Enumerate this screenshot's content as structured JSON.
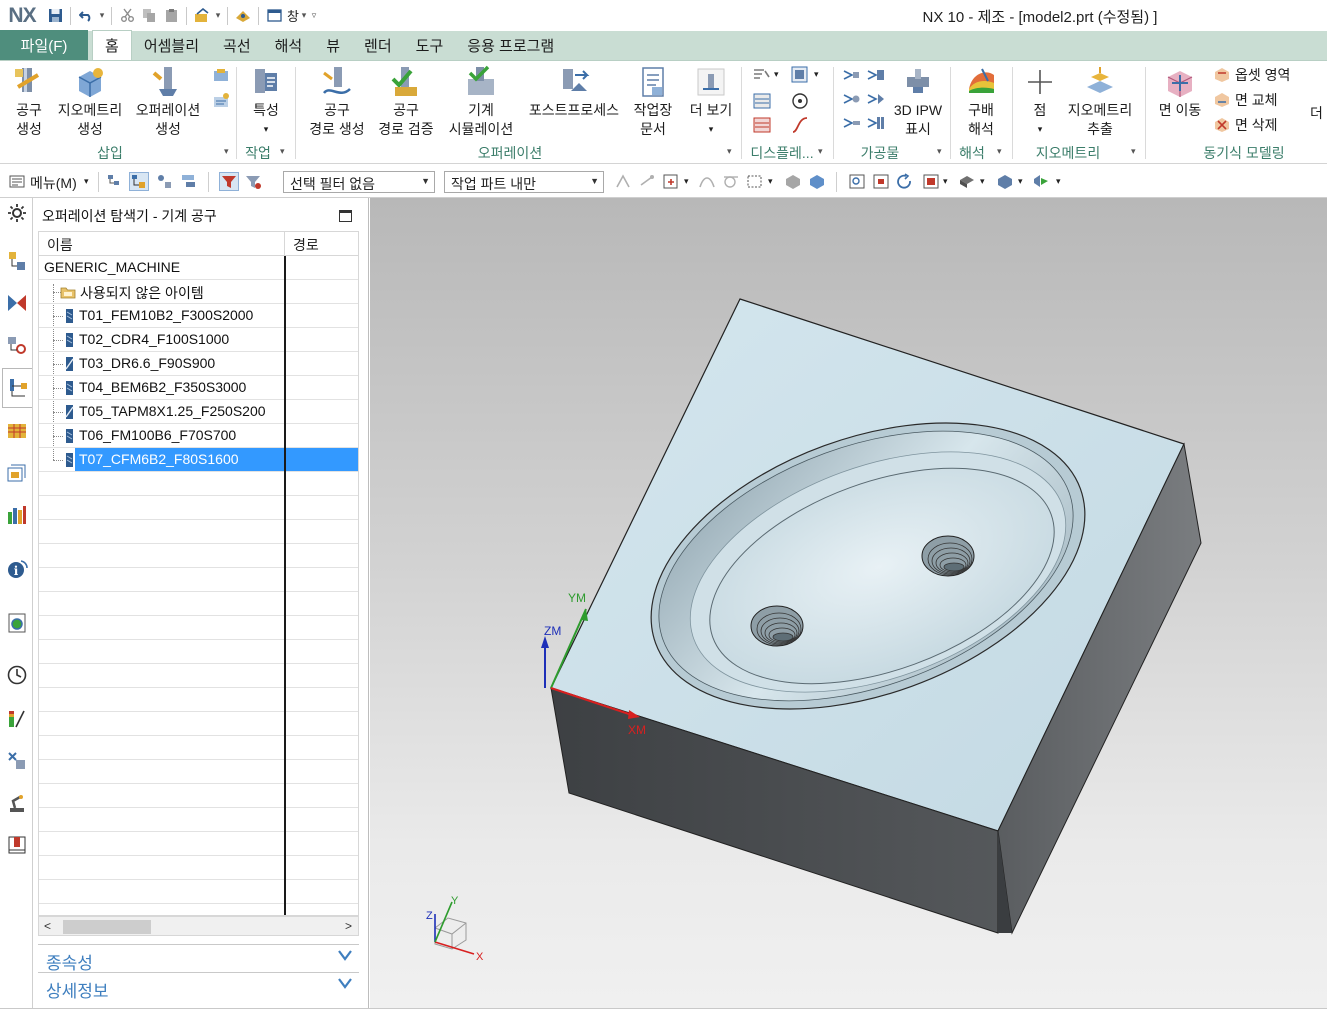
{
  "app": {
    "logo": "NX",
    "window_title": "NX 10 - 제조 - [model2.prt (수정됨) ]",
    "quick_access_window_label": "창"
  },
  "tabs": [
    {
      "label": "파일(F)"
    },
    {
      "label": "홈"
    },
    {
      "label": "어셈블리"
    },
    {
      "label": "곡선"
    },
    {
      "label": "해석"
    },
    {
      "label": "뷰"
    },
    {
      "label": "렌더"
    },
    {
      "label": "도구"
    },
    {
      "label": "응용 프로그램"
    }
  ],
  "ribbon": {
    "buttons": {
      "create_tool": [
        "공구",
        "생성"
      ],
      "create_geometry": [
        "지오메트리",
        "생성"
      ],
      "create_operation": [
        "오퍼레이션",
        "생성"
      ],
      "properties": [
        "특성"
      ],
      "generate_toolpath": [
        "공구",
        "경로 생성"
      ],
      "verify_toolpath": [
        "공구",
        "경로 검증"
      ],
      "machine_simulation": [
        "기계",
        "시뮬레이션"
      ],
      "postprocess": [
        "포스트프로세스"
      ],
      "shop_docs": [
        "작업장",
        "문서"
      ],
      "more": [
        "더 보기"
      ],
      "show_3d_ipw": [
        "3D IPW",
        "표시"
      ],
      "gradient_analysis": [
        "구배",
        "해석"
      ],
      "point": [
        "점"
      ],
      "extract_geometry": [
        "지오메트리",
        "추출"
      ],
      "move_face": [
        "면 이동"
      ],
      "offset_region": "옵셋 영역",
      "replace_face": "면 교체",
      "delete_face": "면 삭제",
      "more_overflow": "더"
    },
    "groups": {
      "insert": "삽입",
      "actions": "작업",
      "operations": "오퍼레이션",
      "display": "디스플레...",
      "workpiece": "가공물",
      "analysis": "해석",
      "geometry": "지오메트리",
      "sync_modeling": "동기식 모델링"
    }
  },
  "toolbar2": {
    "menu_label": "메뉴(M)",
    "selection_filter": "선택 필터 없음",
    "selection_scope": "작업 파트 내만"
  },
  "navigator": {
    "title": "오퍼레이션 탐색기 - 기계 공구",
    "columns": [
      "이름",
      "경로"
    ],
    "root": "GENERIC_MACHINE",
    "items": [
      {
        "name": "사용되지 않은 아이템",
        "kind": "folder"
      },
      {
        "name": "T01_FEM10B2_F300S2000",
        "kind": "mill"
      },
      {
        "name": "T02_CDR4_F100S1000",
        "kind": "mill"
      },
      {
        "name": "T03_DR6.6_F90S900",
        "kind": "drill"
      },
      {
        "name": "T04_BEM6B2_F350S3000",
        "kind": "mill"
      },
      {
        "name": "T05_TAPM8X1.25_F250S200",
        "kind": "drill"
      },
      {
        "name": "T06_FM100B6_F70S700",
        "kind": "mill"
      },
      {
        "name": "T07_CFM6B2_F80S1600",
        "kind": "mill",
        "selected": true
      }
    ],
    "panels": [
      "종속성",
      "상세정보"
    ]
  },
  "viewport": {
    "wcs_labels": {
      "x": "XM",
      "y": "YM",
      "z": "ZM"
    },
    "triad_labels": {
      "x": "X",
      "y": "Y",
      "z": "Z"
    }
  },
  "colors": {
    "file_tab": "#4f8e7d",
    "tab_strip": "#c9ddd3",
    "group_label": "#3b7d6a",
    "selection": "#3399ff",
    "panel_label": "#3f7fbf",
    "part_top_face": "#cfe2ea",
    "part_side_face": "#4a4d50"
  }
}
